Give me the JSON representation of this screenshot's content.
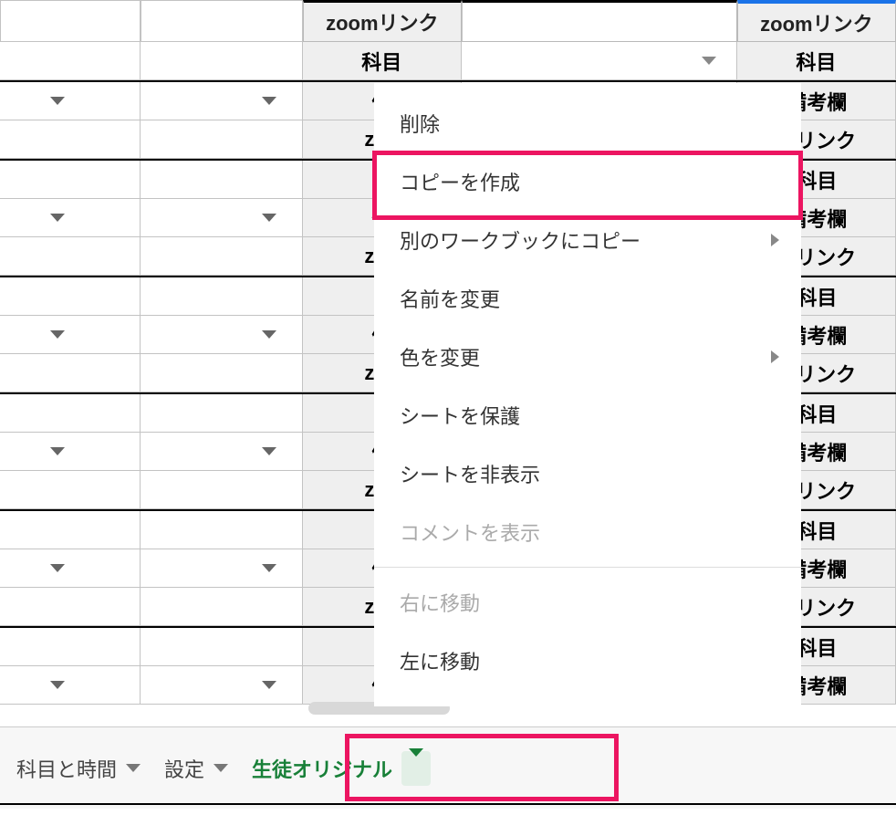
{
  "headers": {
    "colC": "zoomリンク",
    "colE": "zoomリンク"
  },
  "subheader": {
    "colC": "科目",
    "colE": "科目"
  },
  "row_labels": {
    "subject": "科目",
    "remark_partial_left": "備",
    "remark_partial_right": "備考欄",
    "zoom_left": "zoo",
    "zoom_right": "mリンク"
  },
  "tabs": {
    "tab1": "科目と時間",
    "tab2": "設定",
    "tab3_active": "生徒オリジナル"
  },
  "context_menu": {
    "delete": "削除",
    "duplicate": "コピーを作成",
    "copy_to_other": "別のワークブックにコピー",
    "rename": "名前を変更",
    "change_color": "色を変更",
    "protect": "シートを保護",
    "hide": "シートを非表示",
    "view_comments": "コメントを表示",
    "move_right": "右に移動",
    "move_left": "左に移動"
  }
}
